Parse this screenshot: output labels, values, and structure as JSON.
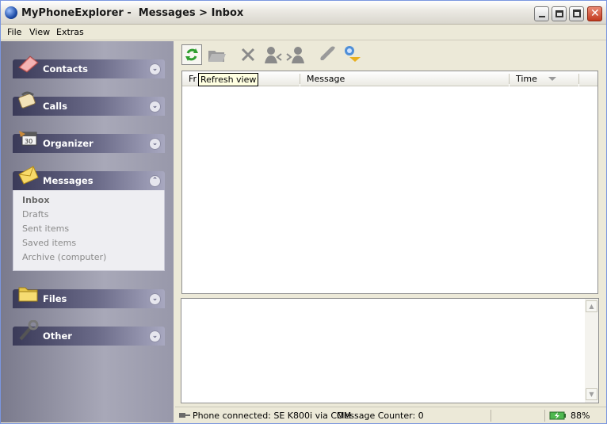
{
  "window": {
    "title": "MyPhoneExplorer -  Messages > Inbox"
  },
  "menu": [
    "File",
    "View",
    "Extras"
  ],
  "sidebar": {
    "sections": [
      {
        "label": "Contacts",
        "icon": "contacts-book-icon",
        "expanded": false
      },
      {
        "label": "Calls",
        "icon": "calls-phone-icon",
        "expanded": false
      },
      {
        "label": "Organizer",
        "icon": "organizer-calendar-icon",
        "expanded": false
      },
      {
        "label": "Messages",
        "icon": "messages-envelope-icon",
        "expanded": true
      },
      {
        "label": "Files",
        "icon": "files-folder-icon",
        "expanded": false
      },
      {
        "label": "Other",
        "icon": "other-tools-icon",
        "expanded": false
      }
    ],
    "messages_items": [
      "Inbox",
      "Drafts",
      "Sent items",
      "Saved items",
      "Archive (computer)"
    ],
    "selected": "Inbox"
  },
  "toolbar": {
    "buttons": [
      "refresh-icon",
      "open-folder-icon",
      "delete-icon",
      "reply-icon",
      "forward-icon",
      "call-icon",
      "send-icon"
    ],
    "tooltip": "Refresh view"
  },
  "list": {
    "columns": [
      "Fr",
      "Message",
      "Time"
    ]
  },
  "status": {
    "connection": "Phone connected: SE K800i via COM",
    "counter": "Message Counter: 0",
    "battery": "88%"
  },
  "colors": {
    "sidebar_header": "#4b4b6b",
    "sidebar_bg": "#a8a8b8",
    "tooltip_bg": "#ffffe1",
    "refresh_green": "#2f9e2f"
  }
}
